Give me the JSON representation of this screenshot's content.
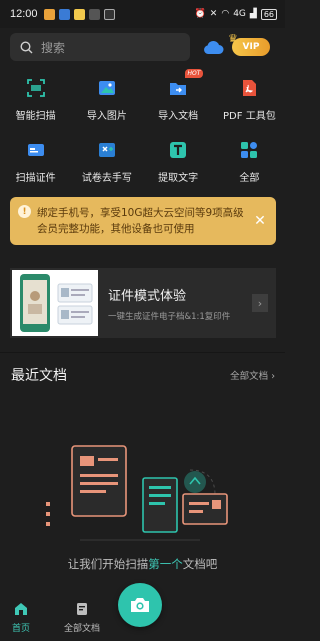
{
  "status_bar": {
    "time": "12:00",
    "network": "4G",
    "battery": "66"
  },
  "search": {
    "placeholder": "搜索"
  },
  "vip": {
    "label": "VIP"
  },
  "tools": [
    {
      "label": "智能扫描",
      "icon": "scan-icon"
    },
    {
      "label": "导入图片",
      "icon": "image-import-icon"
    },
    {
      "label": "导入文档",
      "icon": "folder-import-icon",
      "badge": "HOT"
    },
    {
      "label": "PDF 工具包",
      "icon": "pdf-icon"
    },
    {
      "label": "扫描证件",
      "icon": "id-card-icon"
    },
    {
      "label": "试卷去手写",
      "icon": "exam-erase-icon"
    },
    {
      "label": "提取文字",
      "icon": "text-extract-icon"
    },
    {
      "label": "全部",
      "icon": "all-apps-icon"
    }
  ],
  "banner": {
    "text": "绑定手机号，享受10G超大云空间等9项高级会员完整功能，其他设备也可使用",
    "bg_color": "#e6b95d"
  },
  "promo": {
    "title": "证件模式体验",
    "subtitle": "一键生成证件电子档&1:1复印件"
  },
  "recent": {
    "title": "最近文档",
    "all_link": "全部文档 ›"
  },
  "empty_state": {
    "text_before": "让我们开始扫描",
    "text_highlight": "第一个",
    "text_after": "文档吧"
  },
  "tabbar": {
    "home_label": "首页",
    "docs_label": "全部文档"
  },
  "colors": {
    "accent": "#2ec4ad",
    "background": "#1e1e1e"
  }
}
